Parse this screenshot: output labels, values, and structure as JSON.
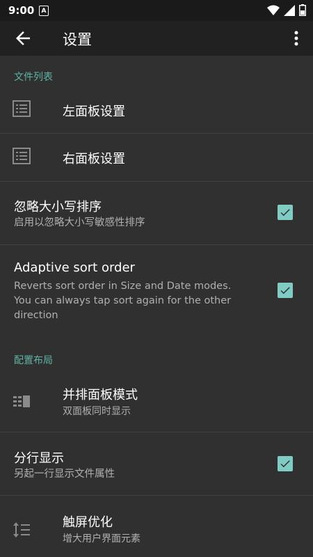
{
  "status_bar": {
    "time": "9:00",
    "notification_icon": "A"
  },
  "app_bar": {
    "title": "设置",
    "back_icon": "arrow-back-icon",
    "more_icon": "more-vert-icon"
  },
  "sections": {
    "file_list": {
      "header": "文件列表",
      "left_panel": {
        "title": "左面板设置",
        "icon": "list-icon"
      },
      "right_panel": {
        "title": "右面板设置",
        "icon": "list-icon"
      },
      "ignore_case": {
        "title": "忽略大小写排序",
        "subtitle": "启用以忽略大小写敏感性排序",
        "checked": true
      },
      "adaptive": {
        "title": "Adaptive sort order",
        "subtitle_line1": "Reverts sort order in Size and Date modes.",
        "subtitle_line2": "You can always tap sort again for the other",
        "subtitle_line3": "direction",
        "checked": true
      }
    },
    "layout": {
      "header": "配置布局",
      "side_by_side": {
        "title": "并排面板模式",
        "subtitle": "双面板同时显示",
        "icon": "side-panels-icon"
      },
      "split_line": {
        "title": "分行显示",
        "subtitle": "另起一行显示文件属性",
        "checked": true
      },
      "touch": {
        "title": "触屏优化",
        "subtitle": "增大用户界面元素",
        "icon": "line-spacing-icon"
      }
    }
  },
  "colors": {
    "accent": "#5fb3a6",
    "checkbox": "#80cbc4",
    "background": "#303030",
    "appbar": "#212121"
  }
}
